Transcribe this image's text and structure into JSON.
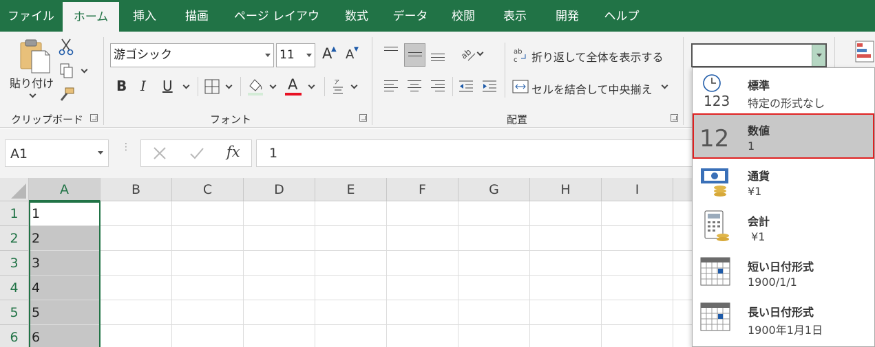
{
  "tabs": [
    "ファイル",
    "ホーム",
    "挿入",
    "描画",
    "ページ レイアウト",
    "数式",
    "データ",
    "校閲",
    "表示",
    "開発",
    "ヘルプ"
  ],
  "active_tab": "ホーム",
  "clipboard": {
    "paste_label": "貼り付け",
    "group_label": "クリップボード"
  },
  "font": {
    "name": "游ゴシック",
    "size": "11",
    "grow_label": "A",
    "shrink_label": "A",
    "bold": "B",
    "italic": "I",
    "underline": "U",
    "font_color_label": "A",
    "group_label": "フォント"
  },
  "alignment": {
    "wrap_text": "折り返して全体を表示する",
    "merge_center": "セルを結合して中央揃え",
    "group_label": "配置"
  },
  "number_format": {
    "current_value": "",
    "options": [
      {
        "name": "標準",
        "example": "特定の形式なし",
        "icon": "clock-123-icon",
        "highlighted": false
      },
      {
        "name": "数値",
        "example": "1",
        "icon": "number-12-icon",
        "highlighted": true
      },
      {
        "name": "通貨",
        "example": "¥1",
        "icon": "currency-icon",
        "highlighted": false
      },
      {
        "name": "会計",
        "example": " ¥1",
        "icon": "accounting-icon",
        "highlighted": false
      },
      {
        "name": "短い日付形式",
        "example": "1900/1/1",
        "icon": "calendar-icon",
        "highlighted": false
      },
      {
        "name": "長い日付形式",
        "example": "1900年1月1日",
        "icon": "calendar-icon",
        "highlighted": false
      }
    ]
  },
  "formula_bar": {
    "name_box": "A1",
    "fx_label": "fx",
    "formula": "1"
  },
  "grid": {
    "columns": [
      "A",
      "B",
      "C",
      "D",
      "E",
      "F",
      "G",
      "H",
      "I"
    ],
    "rows": [
      "1",
      "2",
      "3",
      "4",
      "5",
      "6"
    ],
    "column_a_values": [
      "1",
      "2",
      "3",
      "4",
      "5",
      "6"
    ]
  },
  "colors": {
    "accent": "#217346",
    "highlight_border": "#e02020",
    "font_color_bar": "#e81123"
  }
}
